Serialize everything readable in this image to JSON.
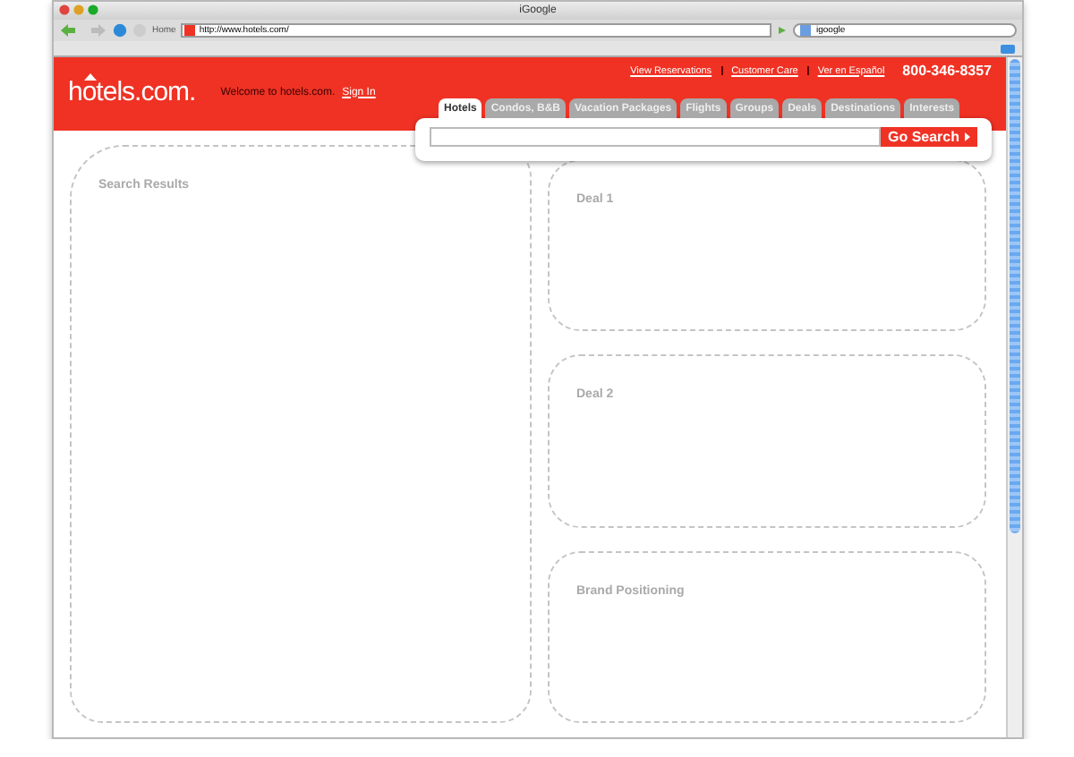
{
  "browser": {
    "title": "iGoogle",
    "home_label": "Home",
    "url": "http://www.hotels.com/",
    "search_value": "igoogle"
  },
  "header": {
    "logo": "hotels.com.",
    "welcome": "Welcome to hotels.com.",
    "sign_in": "Sign In",
    "links": [
      "View Reservations",
      "Customer Care",
      "Ver en Español"
    ],
    "phone": "800-346-8357"
  },
  "search": {
    "tabs": [
      {
        "label": "Hotels",
        "selected": true
      },
      {
        "label": "Condos, B&B",
        "selected": false
      },
      {
        "label": "Vacation Packages",
        "selected": false
      },
      {
        "label": "Flights",
        "selected": false
      },
      {
        "label": "Groups",
        "selected": false
      },
      {
        "label": "Deals",
        "selected": false
      },
      {
        "label": "Destinations",
        "selected": false
      },
      {
        "label": "Interests",
        "selected": false
      }
    ],
    "button": "Go Search"
  },
  "main": {
    "search_results": "Search Results",
    "side_panels": [
      "Deal 1",
      "Deal 2",
      "Brand Positioning"
    ]
  }
}
